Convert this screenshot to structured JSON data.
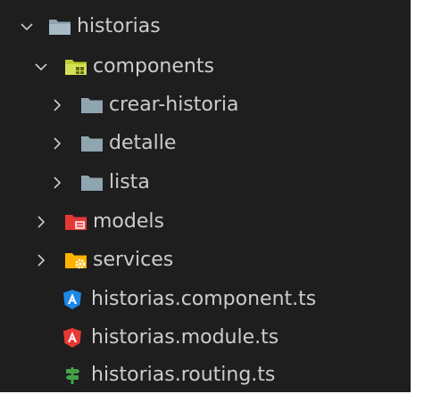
{
  "explorer": {
    "root": {
      "label": "historias",
      "chevron": "chevron-down-icon",
      "icon": "folder-open-icon"
    },
    "components": {
      "label": "components",
      "chevron": "chevron-down-icon",
      "icon": "folder-components-open-icon"
    },
    "crear_historia": {
      "label": "crear-historia",
      "chevron": "chevron-right-icon",
      "icon": "folder-icon"
    },
    "detalle": {
      "label": "detalle",
      "chevron": "chevron-right-icon",
      "icon": "folder-icon"
    },
    "lista": {
      "label": "lista",
      "chevron": "chevron-right-icon",
      "icon": "folder-icon"
    },
    "models": {
      "label": "models",
      "chevron": "chevron-right-icon",
      "icon": "folder-models-icon"
    },
    "services": {
      "label": "services",
      "chevron": "chevron-right-icon",
      "icon": "folder-services-icon"
    },
    "component_ts": {
      "label": "historias.component.ts",
      "icon": "angular-component-icon"
    },
    "module_ts": {
      "label": "historias.module.ts",
      "icon": "angular-module-icon"
    },
    "routing_ts": {
      "label": "historias.routing.ts",
      "icon": "angular-routing-icon"
    }
  },
  "colors": {
    "background": "#1e1e1e",
    "text": "#cccccc",
    "folder": "#8fa5b0",
    "components_folder": "#c0ca33",
    "models_folder": "#e53935",
    "services_folder": "#ffb300",
    "angular_component": "#1e88e5",
    "angular_module": "#e53935",
    "angular_routing": "#43a047"
  }
}
